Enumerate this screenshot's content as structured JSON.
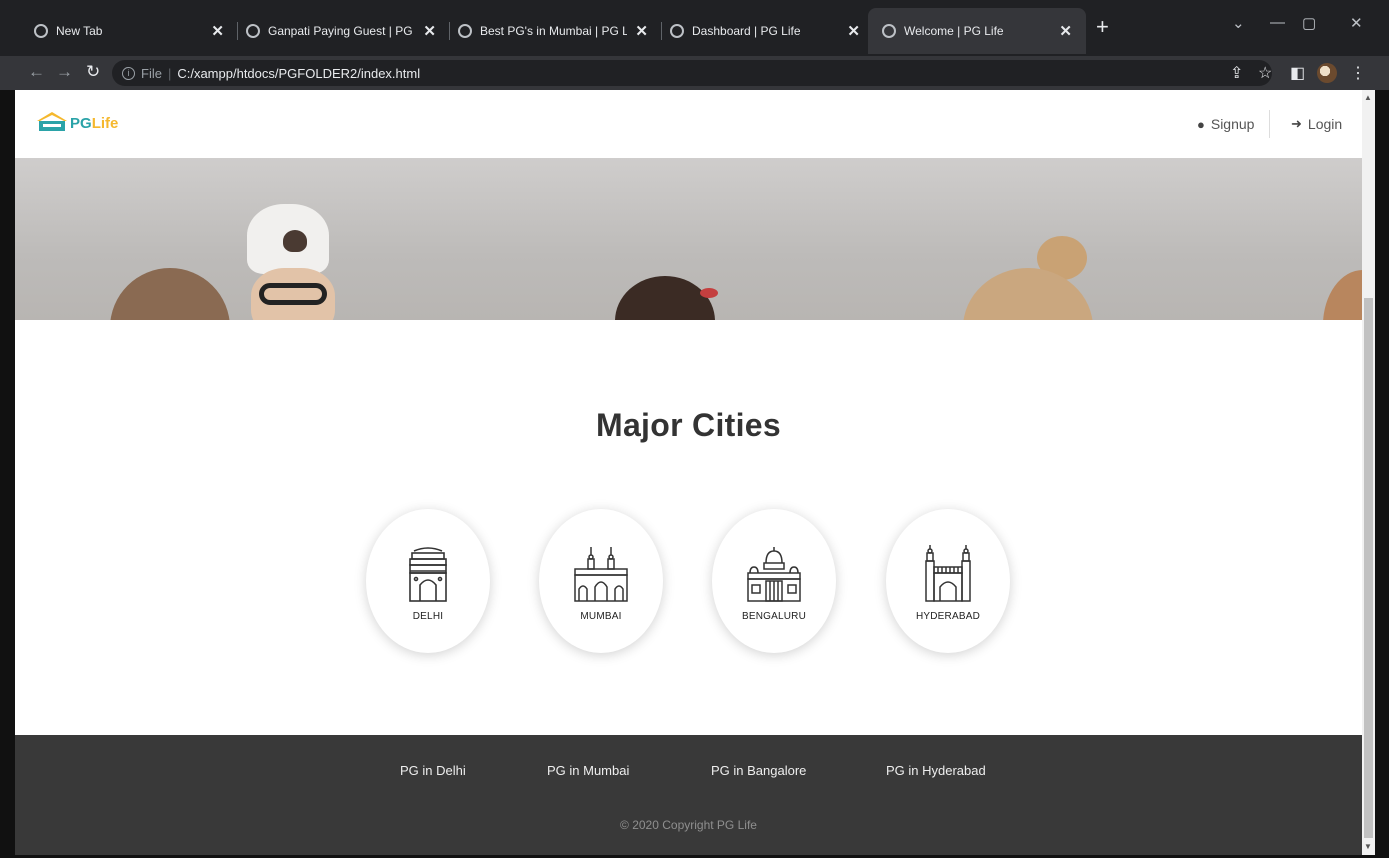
{
  "browser": {
    "tabs": [
      {
        "label": "New Tab",
        "active": false
      },
      {
        "label": "Ganpati Paying Guest | PG Life",
        "active": false
      },
      {
        "label": "Best PG's in Mumbai | PG Life",
        "active": false
      },
      {
        "label": "Dashboard | PG Life",
        "active": false
      },
      {
        "label": "Welcome | PG Life",
        "active": true
      }
    ],
    "address": {
      "scheme": "File",
      "url": "C:/xampp/htdocs/PGFOLDER2/index.html"
    }
  },
  "header": {
    "logo_pg": "PG",
    "logo_life": "Life",
    "signup_label": "Signup",
    "login_label": "Login"
  },
  "main": {
    "section_title": "Major Cities",
    "cities": [
      {
        "name": "DELHI",
        "icon": "india-gate-icon"
      },
      {
        "name": "MUMBAI",
        "icon": "gateway-of-india-icon"
      },
      {
        "name": "BENGALURU",
        "icon": "vidhana-soudha-icon"
      },
      {
        "name": "HYDERABAD",
        "icon": "charminar-icon"
      }
    ]
  },
  "footer": {
    "links": [
      "PG in Delhi",
      "PG in Mumbai",
      "PG in Bangalore",
      "PG in Hyderabad"
    ],
    "copyright": "© 2020 Copyright PG Life"
  },
  "colors": {
    "brand_teal": "#2ba3a8",
    "brand_yellow": "#f5b82e",
    "footer_bg": "#393939"
  }
}
